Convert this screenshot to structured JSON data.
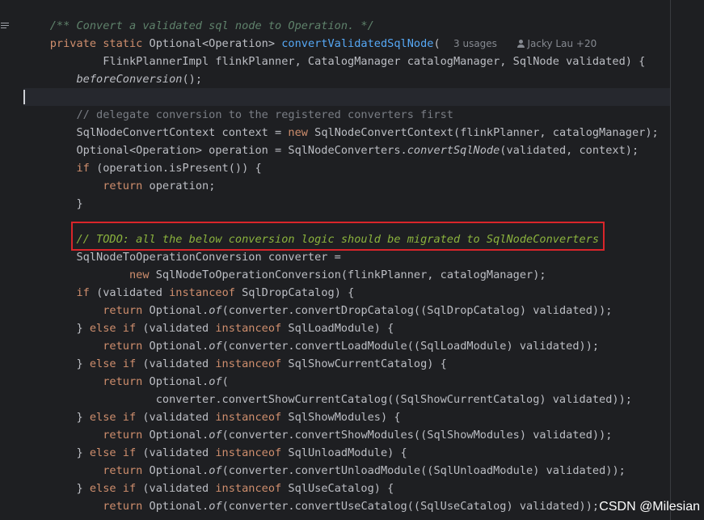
{
  "editor": {
    "hint": {
      "usages": "3 usages",
      "author": "Jacky Lau +20"
    },
    "watermark": "CSDN @Milesian"
  },
  "code": {
    "line1": {
      "doc": "/** Convert a validated sql node to Operation. */"
    },
    "line2": {
      "kw": "private static ",
      "t1": "Optional<Operation> ",
      "fn": "convertValidatedSqlNode",
      "t2": "("
    },
    "line3": {
      "t": "        FlinkPlannerImpl flinkPlanner, CatalogManager catalogManager, SqlNode validated) {"
    },
    "line4": {
      "pre": "    ",
      "it": "beforeConversion",
      "t": "();"
    },
    "line6": {
      "cm": "    // delegate conversion to the registered converters first"
    },
    "line7": {
      "t1": "    SqlNodeConvertContext context = ",
      "kw": "new ",
      "t2": "SqlNodeConvertContext(flinkPlanner, catalogManager);"
    },
    "line8": {
      "t1": "    Optional<Operation> operation = SqlNodeConverters.",
      "it": "convertSqlNode",
      "t2": "(validated, context);"
    },
    "line9": {
      "pre": "    ",
      "kw": "if ",
      "t": "(operation.isPresent()) {"
    },
    "line10": {
      "pre": "        ",
      "kw": "return ",
      "t": "operation;"
    },
    "line11": {
      "t": "    }"
    },
    "line13": {
      "pre": "    ",
      "todo": "// TODO: all the below conversion logic should be migrated to SqlNodeConverters"
    },
    "line14": {
      "t": "    SqlNodeToOperationConversion converter ="
    },
    "line15": {
      "pre": "            ",
      "kw": "new ",
      "t": "SqlNodeToOperationConversion(flinkPlanner, catalogManager);"
    },
    "line16": {
      "pre": "    ",
      "kw1": "if ",
      "t1": "(validated ",
      "kw2": "instanceof ",
      "t2": "SqlDropCatalog) {"
    },
    "line17": {
      "pre": "        ",
      "kw": "return ",
      "t1": "Optional.",
      "it": "of",
      "t2": "(converter.convertDropCatalog((SqlDropCatalog) validated));"
    },
    "line18": {
      "t0": "    } ",
      "kw1": "else if ",
      "t1": "(validated ",
      "kw2": "instanceof ",
      "t2": "SqlLoadModule) {"
    },
    "line19": {
      "pre": "        ",
      "kw": "return ",
      "t1": "Optional.",
      "it": "of",
      "t2": "(converter.convertLoadModule((SqlLoadModule) validated));"
    },
    "line20": {
      "t0": "    } ",
      "kw1": "else if ",
      "t1": "(validated ",
      "kw2": "instanceof ",
      "t2": "SqlShowCurrentCatalog) {"
    },
    "line21": {
      "pre": "        ",
      "kw": "return ",
      "t1": "Optional.",
      "it": "of",
      "t2": "("
    },
    "line22": {
      "t": "                converter.convertShowCurrentCatalog((SqlShowCurrentCatalog) validated));"
    },
    "line23": {
      "t0": "    } ",
      "kw1": "else if ",
      "t1": "(validated ",
      "kw2": "instanceof ",
      "t2": "SqlShowModules) {"
    },
    "line24": {
      "pre": "        ",
      "kw": "return ",
      "t1": "Optional.",
      "it": "of",
      "t2": "(converter.convertShowModules((SqlShowModules) validated));"
    },
    "line25": {
      "t0": "    } ",
      "kw1": "else if ",
      "t1": "(validated ",
      "kw2": "instanceof ",
      "t2": "SqlUnloadModule) {"
    },
    "line26": {
      "pre": "        ",
      "kw": "return ",
      "t1": "Optional.",
      "it": "of",
      "t2": "(converter.convertUnloadModule((SqlUnloadModule) validated));"
    },
    "line27": {
      "t0": "    } ",
      "kw1": "else if ",
      "t1": "(validated ",
      "kw2": "instanceof ",
      "t2": "SqlUseCatalog) {"
    },
    "line28": {
      "pre": "        ",
      "kw": "return ",
      "t1": "Optional.",
      "it": "of",
      "t2": "(converter.convertUseCatalog((SqlUseCatalog) validated));"
    }
  },
  "colors": {
    "background": "#1e1f22",
    "keyword": "#cf8e6d",
    "function": "#56a8f5",
    "comment": "#7a7e85",
    "doc_comment": "#5f826b",
    "todo": "#8bb33d",
    "highlight_border": "#d9252a"
  },
  "icons": {
    "gutter": "structure-menu-icon",
    "author": "person-icon"
  }
}
